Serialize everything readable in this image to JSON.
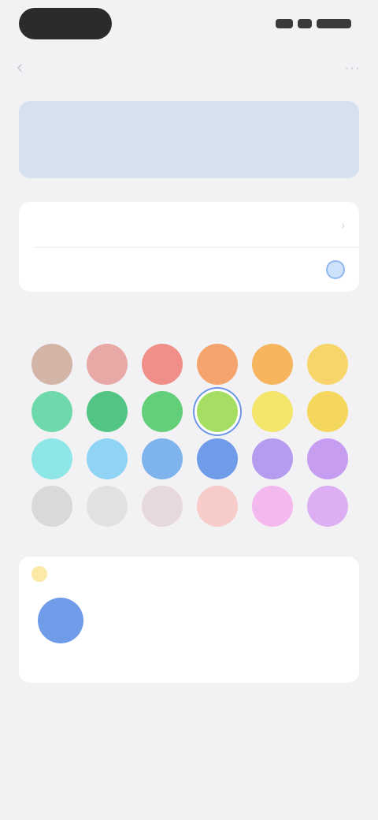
{
  "nav": {
    "title": "",
    "back_icon": "chevron-left-icon",
    "action_icon": "more-icon"
  },
  "status_bar": {
    "time_pill": "",
    "indicators": ""
  },
  "banner": {
    "line1": "",
    "line2": ""
  },
  "settings": {
    "rows": [
      {
        "label": "",
        "value": ""
      },
      {
        "label": "",
        "value": ""
      }
    ]
  },
  "palette": {
    "section_label": "",
    "selected_index": 9,
    "colors": [
      "#d3b5a8",
      "#e8a8a6",
      "#f08e88",
      "#f5a46d",
      "#f6b45c",
      "#f8d56a",
      "#6fd9ab",
      "#52c483",
      "#63cf79",
      "#a5de63",
      "#f4e56c",
      "#f6d75e",
      "#8ee6e6",
      "#8fd3f5",
      "#7eb3ee",
      "#6f9be9",
      "#b69cf0",
      "#c79df2",
      "#d9d9dc",
      "#e2e2e5",
      "#e7d8dc",
      "#f6cbc9",
      "#f3b8ee",
      "#dcaff2"
    ]
  },
  "preview": {
    "title": "",
    "caption": "",
    "color": "#6f9be9"
  },
  "footer": {
    "line1": "",
    "line2": ""
  }
}
